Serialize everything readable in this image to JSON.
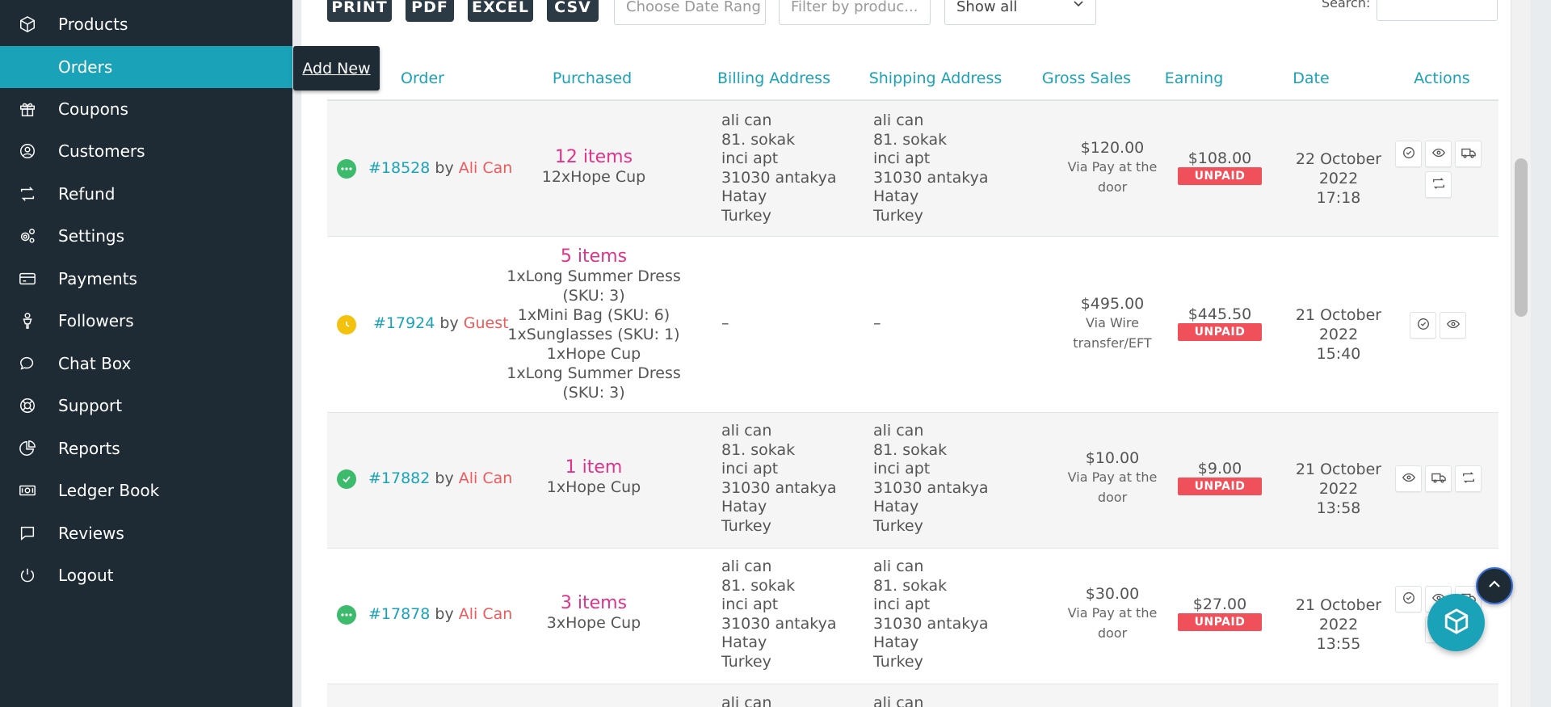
{
  "sidebar": {
    "items": [
      {
        "label": "Products",
        "icon": "cube-icon"
      },
      {
        "label": "Orders",
        "icon": "cart-icon",
        "active": true
      },
      {
        "label": "Coupons",
        "icon": "gift-icon"
      },
      {
        "label": "Customers",
        "icon": "user-circle-icon"
      },
      {
        "label": "Refund",
        "icon": "retweet-icon"
      },
      {
        "label": "Settings",
        "icon": "gears-icon"
      },
      {
        "label": "Payments",
        "icon": "credit-card-icon"
      },
      {
        "label": "Followers",
        "icon": "person-icon"
      },
      {
        "label": "Chat Box",
        "icon": "chat-icon"
      },
      {
        "label": "Support",
        "icon": "lifering-icon"
      },
      {
        "label": "Reports",
        "icon": "pie-chart-icon"
      },
      {
        "label": "Ledger Book",
        "icon": "money-icon"
      },
      {
        "label": "Reviews",
        "icon": "comment-icon"
      },
      {
        "label": "Logout",
        "icon": "power-icon"
      }
    ]
  },
  "tooltip": "Add New",
  "toolbar": {
    "print": "PRINT",
    "pdf": "PDF",
    "excel": "EXCEL",
    "csv": "CSV",
    "date_placeholder": "Choose Date Rang",
    "product_placeholder": "Filter by produc...",
    "show_select": "Show all",
    "search_label": "Search:"
  },
  "table": {
    "headers": {
      "order": "Order",
      "purchased": "Purchased",
      "billing": "Billing Address",
      "shipping": "Shipping Address",
      "gross": "Gross Sales",
      "earning": "Earning",
      "date": "Date",
      "actions": "Actions"
    },
    "by": "by",
    "rows": [
      {
        "status": "processing",
        "status_color": "#3dbb6c",
        "order": "#18528",
        "customer": "Ali Can",
        "items_count": "12 items",
        "items": [
          "12xHope Cup"
        ],
        "billing": [
          "ali can",
          "81. sokak",
          "inci apt",
          "31030 antakya",
          "Hatay",
          "Turkey"
        ],
        "shipping": [
          "ali can",
          "81. sokak",
          "inci apt",
          "31030 antakya",
          "Hatay",
          "Turkey"
        ],
        "gross": "$120.00",
        "gross_via": [
          "Via Pay at the",
          "door"
        ],
        "earning": "$108.00",
        "payment_status": "UNPAID",
        "date": [
          "22 October 2022",
          "17:18"
        ],
        "actions": [
          "check-icon",
          "eye-icon",
          "truck-icon",
          "retweet-icon"
        ]
      },
      {
        "status": "pending",
        "status_color": "#f2c20f",
        "order": "#17924",
        "customer": "Guest",
        "items_count": "5 items",
        "items": [
          "1xLong Summer Dress",
          "(SKU: 3)",
          "1xMini Bag (SKU: 6)",
          "1xSunglasses (SKU: 1)",
          "1xHope Cup",
          "1xLong Summer Dress",
          "(SKU: 3)"
        ],
        "billing": [
          "–"
        ],
        "shipping": [
          "–"
        ],
        "gross": "$495.00",
        "gross_via": [
          "Via Wire",
          "transfer/EFT"
        ],
        "earning": "$445.50",
        "payment_status": "UNPAID",
        "date": [
          "21 October 2022",
          "15:40"
        ],
        "actions": [
          "check-icon",
          "eye-icon"
        ]
      },
      {
        "status": "completed",
        "status_color": "#3dbb6c",
        "order": "#17882",
        "customer": "Ali Can",
        "items_count": "1 item",
        "items": [
          "1xHope Cup"
        ],
        "billing": [
          "ali can",
          "81. sokak",
          "inci apt",
          "31030 antakya",
          "Hatay",
          "Turkey"
        ],
        "shipping": [
          "ali can",
          "81. sokak",
          "inci apt",
          "31030 antakya",
          "Hatay",
          "Turkey"
        ],
        "gross": "$10.00",
        "gross_via": [
          "Via Pay at the",
          "door"
        ],
        "earning": "$9.00",
        "payment_status": "UNPAID",
        "date": [
          "21 October 2022",
          "13:58"
        ],
        "actions": [
          "eye-icon",
          "truck-icon",
          "retweet-icon"
        ]
      },
      {
        "status": "processing",
        "status_color": "#3dbb6c",
        "order": "#17878",
        "customer": "Ali Can",
        "items_count": "3 items",
        "items": [
          "3xHope Cup"
        ],
        "billing": [
          "ali can",
          "81. sokak",
          "inci apt",
          "31030 antakya",
          "Hatay",
          "Turkey"
        ],
        "shipping": [
          "ali can",
          "81. sokak",
          "inci apt",
          "31030 antakya",
          "Hatay",
          "Turkey"
        ],
        "gross": "$30.00",
        "gross_via": [
          "Via Pay at the",
          "door"
        ],
        "earning": "$27.00",
        "payment_status": "UNPAID",
        "date": [
          "21 October 2022",
          "13:55"
        ],
        "actions": [
          "check-icon",
          "eye-icon",
          "truck-icon",
          "retweet-icon"
        ]
      },
      {
        "billing": [
          "ali can"
        ],
        "shipping": [
          "ali can"
        ]
      }
    ]
  },
  "colors": {
    "sidebar_bg": "#1e2b35",
    "accent": "#1aa3b8",
    "unpaid": "#f0505a",
    "items_pink": "#e0338a",
    "customer_red": "#f05a5a"
  }
}
